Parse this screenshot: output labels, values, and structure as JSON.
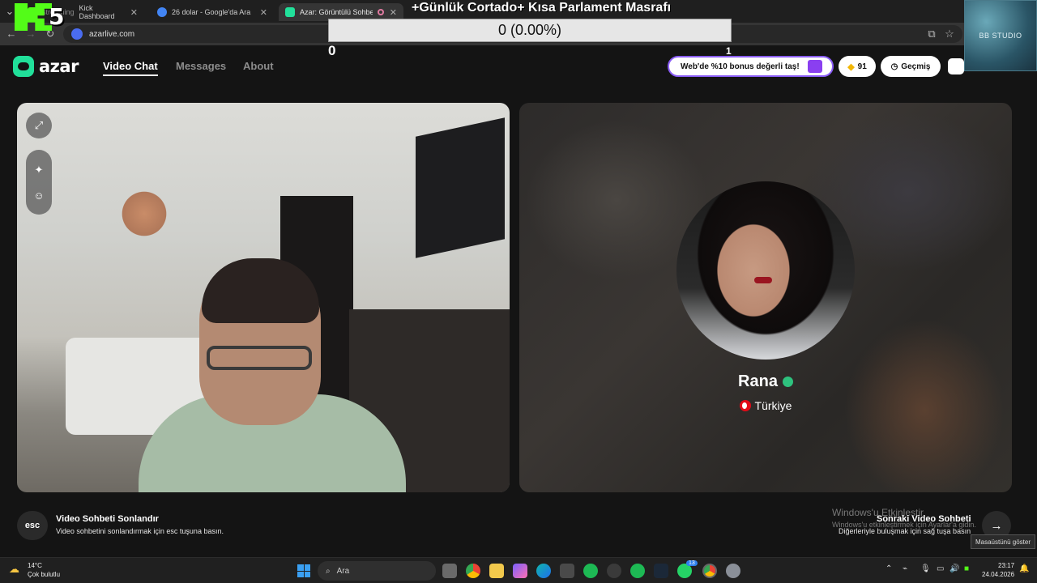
{
  "browser": {
    "tabs": [
      {
        "label": "Kick Dashboard",
        "prefix": "streaming",
        "favicon_color": "#53fc18"
      },
      {
        "label": "26 dolar - Google'da Ara",
        "favicon_color": "#4285f4"
      },
      {
        "label": "Azar: Görüntülü Sohbet & \\",
        "favicon_color": "#21e09a",
        "active": true
      }
    ],
    "url": "azarlive.com"
  },
  "stream_overlay": {
    "kick_number": "5",
    "title": "+Günlük Cortado+ Kısa Parlament Masrafı",
    "progress_text": "0 (0.00%)",
    "progress_fraction": 0.0,
    "progress_min": "0",
    "progress_max": "1",
    "studio_label": "BB STUDIO"
  },
  "azar": {
    "logo_text": "azar",
    "nav": {
      "video_chat": "Video Chat",
      "messages": "Messages",
      "about": "About"
    },
    "promo": "Web'de %10 bonus değerli taş!",
    "gems": "91",
    "history": "Geçmiş"
  },
  "remote": {
    "name": "Rana",
    "country": "Türkiye"
  },
  "hints": {
    "esc_key": "esc",
    "end_title": "Video Sohbeti Sonlandır",
    "end_desc": "Video sohbetini sonlandırmak için esc tuşuna basın.",
    "next_title": "Sonraki Video Sohbeti",
    "next_desc": "Diğerleriyle buluşmak için sağ tuşa basın",
    "win_activate_title": "Windows'u Etkinleştir",
    "win_activate_desc": "Windows'u etkinleştirmek için Ayarlar'a gidin.",
    "tooltip": "Masaüstünü göster"
  },
  "taskbar": {
    "temperature": "14°C",
    "weather": "Çok bulutlu",
    "search_placeholder": "Ara",
    "time": "23:17",
    "date": "24.04.2026",
    "badge_count": "13"
  }
}
